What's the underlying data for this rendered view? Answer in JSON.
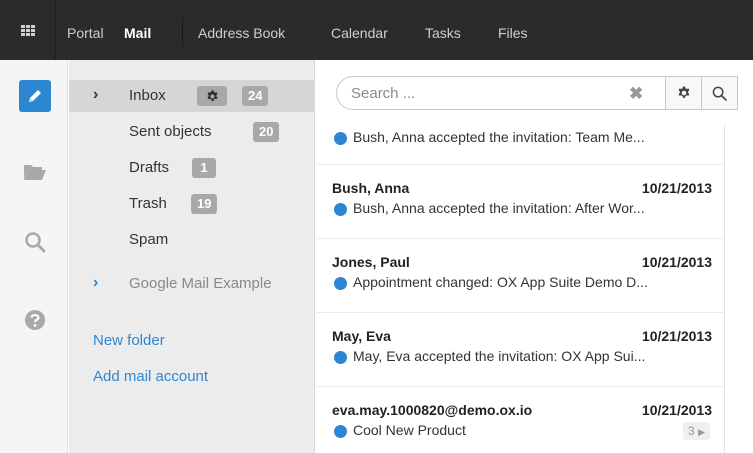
{
  "topbar": {
    "apps_icon": "apps-grid-icon",
    "nav": [
      {
        "label": "Portal",
        "active": false
      },
      {
        "label": "Mail",
        "active": true
      },
      {
        "label": "Address Book",
        "active": false
      },
      {
        "label": "Calendar",
        "active": false
      },
      {
        "label": "Tasks",
        "active": false
      },
      {
        "label": "Files",
        "active": false
      }
    ]
  },
  "rail": {
    "icons": [
      "pencil-icon",
      "folder-icon",
      "search-icon",
      "help-icon"
    ]
  },
  "folders": {
    "inbox": {
      "label": "Inbox",
      "count": "24"
    },
    "sent": {
      "label": "Sent objects",
      "count": "20"
    },
    "drafts": {
      "label": "Drafts",
      "count": "1"
    },
    "trash": {
      "label": "Trash",
      "count": "19"
    },
    "spam": {
      "label": "Spam"
    },
    "google": {
      "label": "Google Mail Example"
    },
    "new_folder": "New folder",
    "add_account": "Add mail account"
  },
  "search": {
    "placeholder": "Search ...",
    "value": ""
  },
  "mails": [
    {
      "from": "",
      "date": "",
      "subject": "Bush, Anna accepted the invitation: Team Me..."
    },
    {
      "from": "Bush, Anna",
      "date": "10/21/2013",
      "subject": "Bush, Anna accepted the invitation: After Wor..."
    },
    {
      "from": "Jones, Paul",
      "date": "10/21/2013",
      "subject": "Appointment changed: OX App Suite Demo D..."
    },
    {
      "from": "May, Eva",
      "date": "10/21/2013",
      "subject": "May, Eva accepted the invitation: OX App Sui..."
    },
    {
      "from": "eva.may.1000820@demo.ox.io",
      "date": "10/21/2013",
      "subject": "Cool New Product",
      "thread_count": "3"
    }
  ],
  "colors": {
    "accent": "#2d86d1",
    "topbar": "#2b2b2b",
    "badge": "#a8a8a8"
  }
}
